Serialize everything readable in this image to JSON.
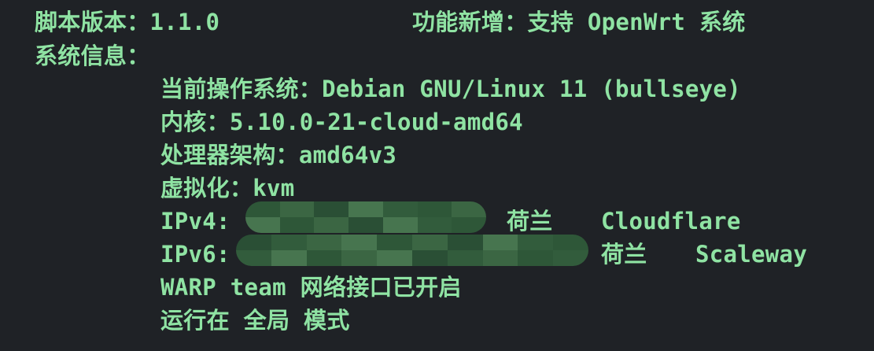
{
  "header": {
    "version_label": "脚本版本：",
    "version": "1.1.0",
    "feature_label": "功能新增：",
    "feature": "支持 OpenWrt 系统"
  },
  "system_info": {
    "title": "系统信息：",
    "os_label": "当前操作系统：",
    "os": "Debian GNU/Linux 11 (bullseye)",
    "kernel_label": "内核：",
    "kernel": "5.10.0-21-cloud-amd64",
    "arch_label": "处理器架构：",
    "arch": "amd64v3",
    "virt_label": "虚拟化：",
    "virt": "kvm",
    "ipv4_label": "IPv4:",
    "ipv4_country": "荷兰",
    "ipv4_isp": "Cloudflare",
    "ipv6_label": "IPv6:",
    "ipv6_country": "荷兰",
    "ipv6_isp": "Scaleway",
    "warp_status": "WARP team 网络接口已开启",
    "mode": "运行在 全局 模式"
  },
  "colors": {
    "background": "#1f2226",
    "text": "#8fe3a3",
    "mask_dark": "#2f5a3a",
    "mask_light": "#4a7a52"
  }
}
